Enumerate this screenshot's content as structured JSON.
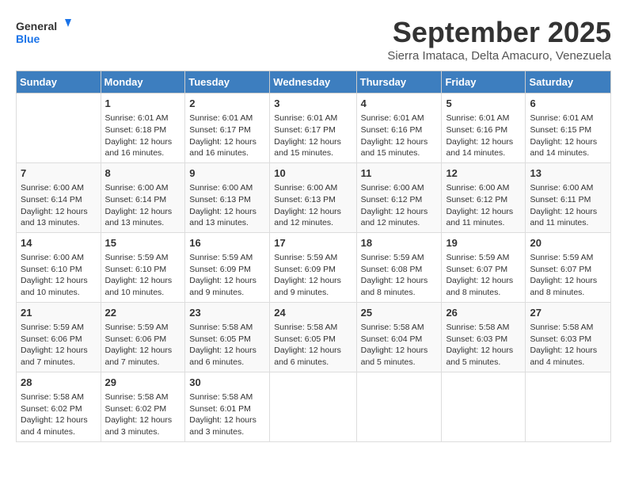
{
  "header": {
    "logo_general": "General",
    "logo_blue": "Blue",
    "month_title": "September 2025",
    "subtitle": "Sierra Imataca, Delta Amacuro, Venezuela"
  },
  "days_of_week": [
    "Sunday",
    "Monday",
    "Tuesday",
    "Wednesday",
    "Thursday",
    "Friday",
    "Saturday"
  ],
  "weeks": [
    [
      {
        "day": "",
        "info": ""
      },
      {
        "day": "1",
        "info": "Sunrise: 6:01 AM\nSunset: 6:18 PM\nDaylight: 12 hours\nand 16 minutes."
      },
      {
        "day": "2",
        "info": "Sunrise: 6:01 AM\nSunset: 6:17 PM\nDaylight: 12 hours\nand 16 minutes."
      },
      {
        "day": "3",
        "info": "Sunrise: 6:01 AM\nSunset: 6:17 PM\nDaylight: 12 hours\nand 15 minutes."
      },
      {
        "day": "4",
        "info": "Sunrise: 6:01 AM\nSunset: 6:16 PM\nDaylight: 12 hours\nand 15 minutes."
      },
      {
        "day": "5",
        "info": "Sunrise: 6:01 AM\nSunset: 6:16 PM\nDaylight: 12 hours\nand 14 minutes."
      },
      {
        "day": "6",
        "info": "Sunrise: 6:01 AM\nSunset: 6:15 PM\nDaylight: 12 hours\nand 14 minutes."
      }
    ],
    [
      {
        "day": "7",
        "info": "Sunrise: 6:00 AM\nSunset: 6:14 PM\nDaylight: 12 hours\nand 13 minutes."
      },
      {
        "day": "8",
        "info": "Sunrise: 6:00 AM\nSunset: 6:14 PM\nDaylight: 12 hours\nand 13 minutes."
      },
      {
        "day": "9",
        "info": "Sunrise: 6:00 AM\nSunset: 6:13 PM\nDaylight: 12 hours\nand 13 minutes."
      },
      {
        "day": "10",
        "info": "Sunrise: 6:00 AM\nSunset: 6:13 PM\nDaylight: 12 hours\nand 12 minutes."
      },
      {
        "day": "11",
        "info": "Sunrise: 6:00 AM\nSunset: 6:12 PM\nDaylight: 12 hours\nand 12 minutes."
      },
      {
        "day": "12",
        "info": "Sunrise: 6:00 AM\nSunset: 6:12 PM\nDaylight: 12 hours\nand 11 minutes."
      },
      {
        "day": "13",
        "info": "Sunrise: 6:00 AM\nSunset: 6:11 PM\nDaylight: 12 hours\nand 11 minutes."
      }
    ],
    [
      {
        "day": "14",
        "info": "Sunrise: 6:00 AM\nSunset: 6:10 PM\nDaylight: 12 hours\nand 10 minutes."
      },
      {
        "day": "15",
        "info": "Sunrise: 5:59 AM\nSunset: 6:10 PM\nDaylight: 12 hours\nand 10 minutes."
      },
      {
        "day": "16",
        "info": "Sunrise: 5:59 AM\nSunset: 6:09 PM\nDaylight: 12 hours\nand 9 minutes."
      },
      {
        "day": "17",
        "info": "Sunrise: 5:59 AM\nSunset: 6:09 PM\nDaylight: 12 hours\nand 9 minutes."
      },
      {
        "day": "18",
        "info": "Sunrise: 5:59 AM\nSunset: 6:08 PM\nDaylight: 12 hours\nand 8 minutes."
      },
      {
        "day": "19",
        "info": "Sunrise: 5:59 AM\nSunset: 6:07 PM\nDaylight: 12 hours\nand 8 minutes."
      },
      {
        "day": "20",
        "info": "Sunrise: 5:59 AM\nSunset: 6:07 PM\nDaylight: 12 hours\nand 8 minutes."
      }
    ],
    [
      {
        "day": "21",
        "info": "Sunrise: 5:59 AM\nSunset: 6:06 PM\nDaylight: 12 hours\nand 7 minutes."
      },
      {
        "day": "22",
        "info": "Sunrise: 5:59 AM\nSunset: 6:06 PM\nDaylight: 12 hours\nand 7 minutes."
      },
      {
        "day": "23",
        "info": "Sunrise: 5:58 AM\nSunset: 6:05 PM\nDaylight: 12 hours\nand 6 minutes."
      },
      {
        "day": "24",
        "info": "Sunrise: 5:58 AM\nSunset: 6:05 PM\nDaylight: 12 hours\nand 6 minutes."
      },
      {
        "day": "25",
        "info": "Sunrise: 5:58 AM\nSunset: 6:04 PM\nDaylight: 12 hours\nand 5 minutes."
      },
      {
        "day": "26",
        "info": "Sunrise: 5:58 AM\nSunset: 6:03 PM\nDaylight: 12 hours\nand 5 minutes."
      },
      {
        "day": "27",
        "info": "Sunrise: 5:58 AM\nSunset: 6:03 PM\nDaylight: 12 hours\nand 4 minutes."
      }
    ],
    [
      {
        "day": "28",
        "info": "Sunrise: 5:58 AM\nSunset: 6:02 PM\nDaylight: 12 hours\nand 4 minutes."
      },
      {
        "day": "29",
        "info": "Sunrise: 5:58 AM\nSunset: 6:02 PM\nDaylight: 12 hours\nand 3 minutes."
      },
      {
        "day": "30",
        "info": "Sunrise: 5:58 AM\nSunset: 6:01 PM\nDaylight: 12 hours\nand 3 minutes."
      },
      {
        "day": "",
        "info": ""
      },
      {
        "day": "",
        "info": ""
      },
      {
        "day": "",
        "info": ""
      },
      {
        "day": "",
        "info": ""
      }
    ]
  ]
}
